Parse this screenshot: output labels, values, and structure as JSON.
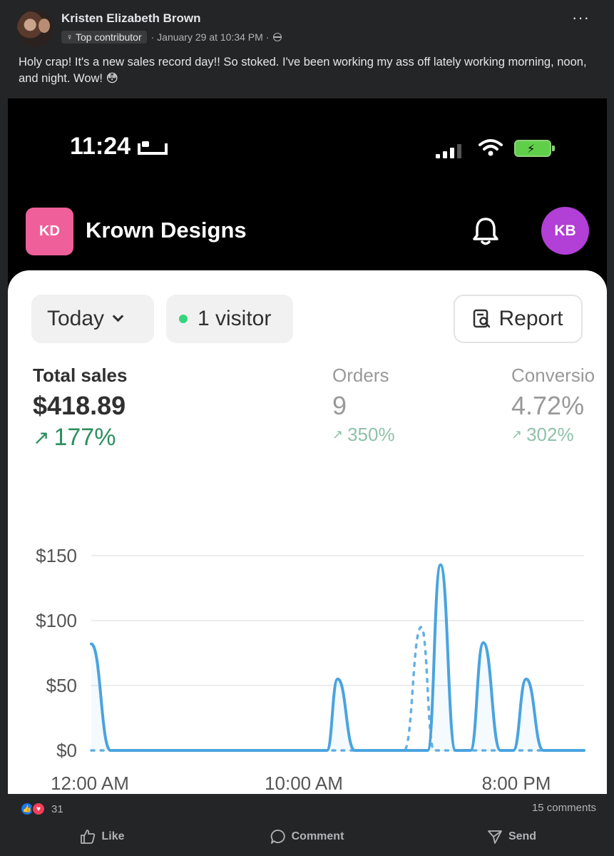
{
  "post": {
    "author": "Kristen Elizabeth Brown",
    "badge": "Top contributor",
    "timestamp": "· January 29 at 10:34 PM ·",
    "text": "Holy crap! It's a new sales record day!! So stoked. I've been working my ass off lately working morning, noon, and night. Wow! 😳",
    "more_label": "···",
    "reaction_count": "31",
    "comments_count": "15 comments",
    "actions": {
      "like": "Like",
      "comment": "Comment",
      "send": "Send"
    }
  },
  "phone": {
    "time": "11:24",
    "store_initials": "KD",
    "store_name": "Krown Designs",
    "user_initials": "KB",
    "filter": "Today",
    "visitors": "1 visitor",
    "report_label": "Report",
    "metrics": [
      {
        "label": "Total sales",
        "value": "$418.89",
        "change": "177%"
      },
      {
        "label": "Orders",
        "value": "9",
        "change": "350%"
      },
      {
        "label": "Conversio",
        "value": "4.72%",
        "change": "302%"
      }
    ]
  },
  "colors": {
    "store_logo": "#ef5f9a",
    "user_avatar": "#b23fd6",
    "series_line": "#4aa3df",
    "positive": "#2e8f5f",
    "visitor_dot": "#36d47c"
  },
  "chart_data": {
    "type": "line",
    "x_ticks": [
      "12:00 AM",
      "10:00 AM",
      "8:00 PM"
    ],
    "x_range": [
      0,
      23
    ],
    "y_ticks": [
      "$150",
      "$100",
      "$50",
      "$0"
    ],
    "y_values": [
      150,
      100,
      50,
      0
    ],
    "ylim": [
      0,
      150
    ],
    "grid": true,
    "series": [
      {
        "style": "solid",
        "points": [
          [
            0,
            82
          ],
          [
            0.9,
            0
          ],
          [
            11,
            0
          ],
          [
            11.5,
            55
          ],
          [
            12.3,
            0
          ],
          [
            15.7,
            0
          ],
          [
            16.3,
            143
          ],
          [
            17,
            0
          ],
          [
            17.7,
            0
          ],
          [
            18.3,
            83
          ],
          [
            19.1,
            0
          ],
          [
            19.7,
            0
          ],
          [
            20.3,
            55
          ],
          [
            21.1,
            0
          ],
          [
            23,
            0
          ]
        ]
      },
      {
        "style": "dashed",
        "points": [
          [
            0,
            0
          ],
          [
            14.6,
            0
          ],
          [
            15.4,
            95
          ],
          [
            16,
            0
          ],
          [
            23,
            0
          ]
        ]
      }
    ]
  }
}
